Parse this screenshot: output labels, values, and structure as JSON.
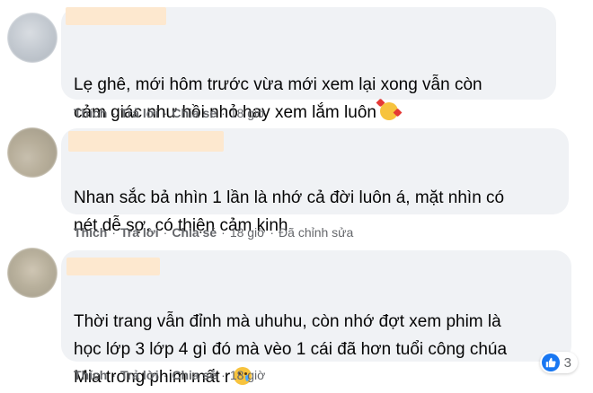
{
  "comments": [
    {
      "text": "Lẹ ghê, mới hôm trước vừa mới xem lại xong vẫn còn\ncảm giác như hồi nhỏ hay xem lắm luôn",
      "emoji": "smiling-face-with-hearts-icon",
      "actions": {
        "like": "Thích",
        "reply": "Trả lời",
        "share": "Chia sẻ",
        "time": "18 giờ"
      }
    },
    {
      "text": "Nhan sắc bả nhìn 1 lần là nhớ cả đời luôn á, mặt nhìn có\nnét dễ sợ, có thiện cảm kinh",
      "actions": {
        "like": "Thích",
        "reply": "Trả lời",
        "share": "Chia sẻ",
        "time": "18 giờ",
        "edited": "Đã chỉnh sửa"
      }
    },
    {
      "text": "Thời trang vẫn đỉnh mà uhuhu, còn nhớ đợt xem phim là\nhọc lớp 3 lớp 4 gì đó mà vèo 1 cái đã hơn tuổi công chúa\nMia trong phim mất r",
      "emoji": "crying-face-icon",
      "actions": {
        "like": "Thích",
        "reply": "Trả lời",
        "share": "Chia sẻ",
        "time": "18 giờ"
      }
    }
  ],
  "reactions": {
    "icon": "like-icon",
    "count": "3"
  },
  "colors": {
    "bubble": "#f0f2f5",
    "meta": "#65676b",
    "like_blue": "#1877f2",
    "redact": "#fde8cf"
  }
}
